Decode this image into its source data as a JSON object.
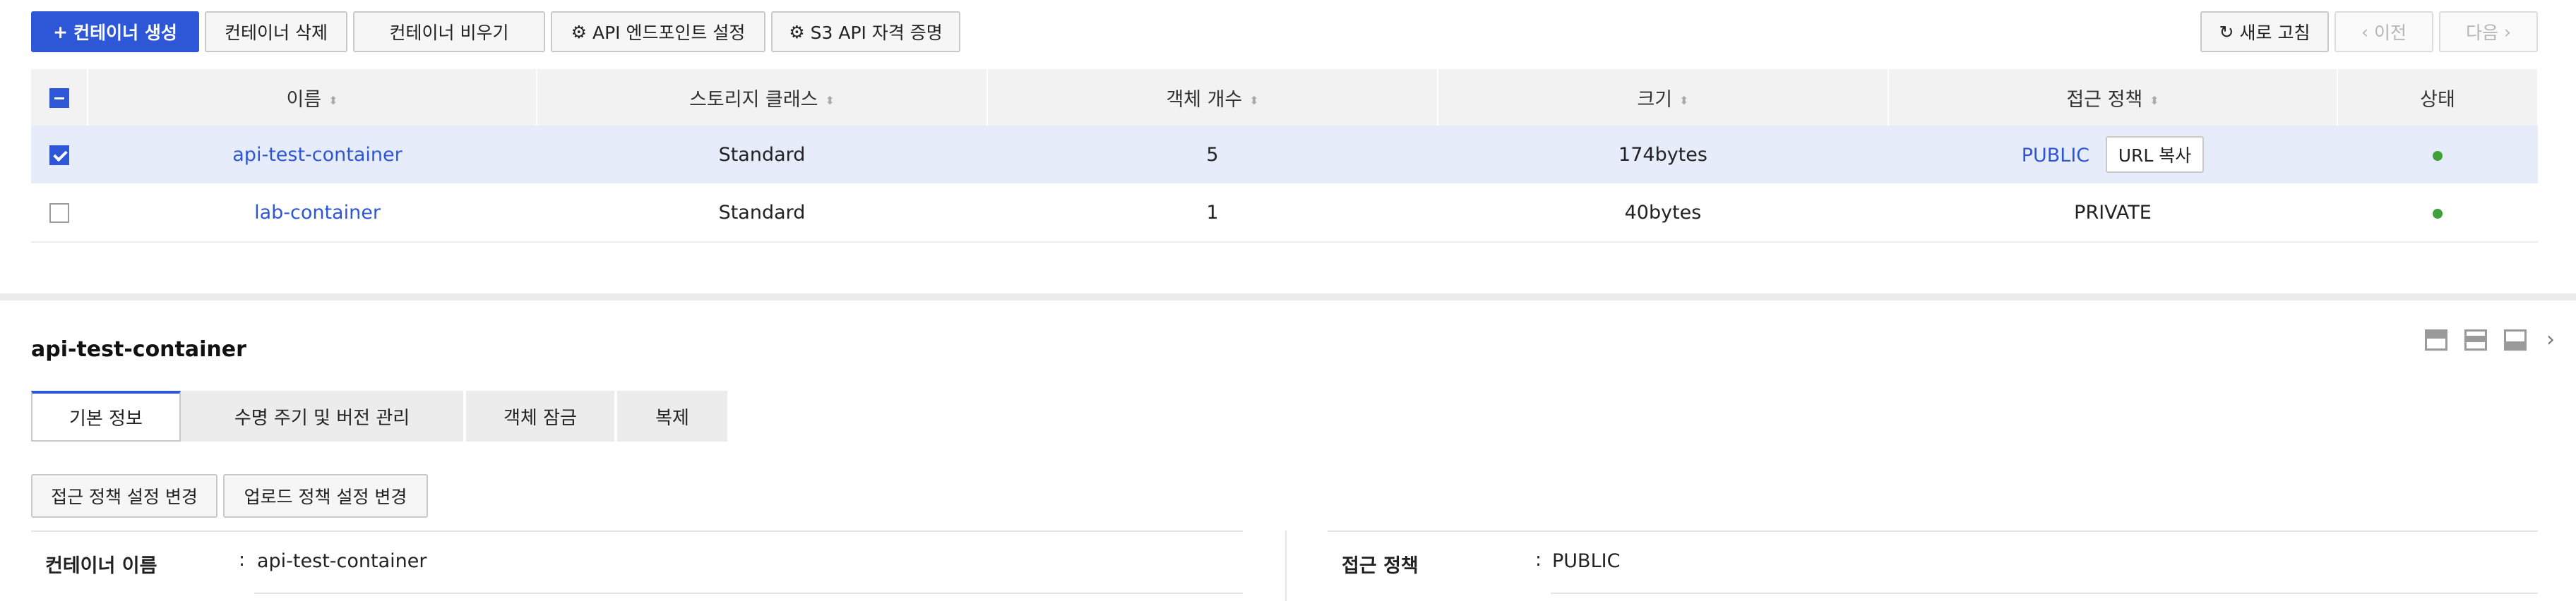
{
  "toolbar": {
    "create_label": "컨테이너 생성",
    "delete_label": "컨테이너 삭제",
    "empty_label": "컨테이너 비우기",
    "api_endpoint_label": "API 엔드포인트 설정",
    "s3_credential_label": "S3 API 자격 증명",
    "refresh_label": "새로 고침",
    "prev_label": "이전",
    "next_label": "다음"
  },
  "table": {
    "headers": [
      "이름",
      "스토리지 클래스",
      "객체 개수",
      "크기",
      "접근 정책",
      "상태"
    ],
    "rows": [
      {
        "name": "api-test-container",
        "storage_class": "Standard",
        "objects": "5",
        "size": "174bytes",
        "policy": "PUBLIC",
        "copy_label": "URL 복사",
        "status": "active"
      },
      {
        "name": "lab-container",
        "storage_class": "Standard",
        "objects": "1",
        "size": "40bytes",
        "policy": "PRIVATE",
        "status": "active"
      }
    ]
  },
  "detail": {
    "title": "api-test-container",
    "tabs": [
      "기본 정보",
      "수명 주기 및 버전 관리",
      "객체 잠금",
      "복제"
    ],
    "actions": [
      "접근 정책 설정 변경",
      "업로드 정책 설정 변경"
    ],
    "info": {
      "container_name_label": "컨테이너 이름",
      "container_name_value": "api-test-container",
      "policy_label": "접근 정책",
      "policy_value": "PUBLIC",
      "colon": ":"
    }
  },
  "colors": {
    "accent": "#2e57d8",
    "status_active": "#3fa13a",
    "selected_row": "#e6ecfa"
  }
}
